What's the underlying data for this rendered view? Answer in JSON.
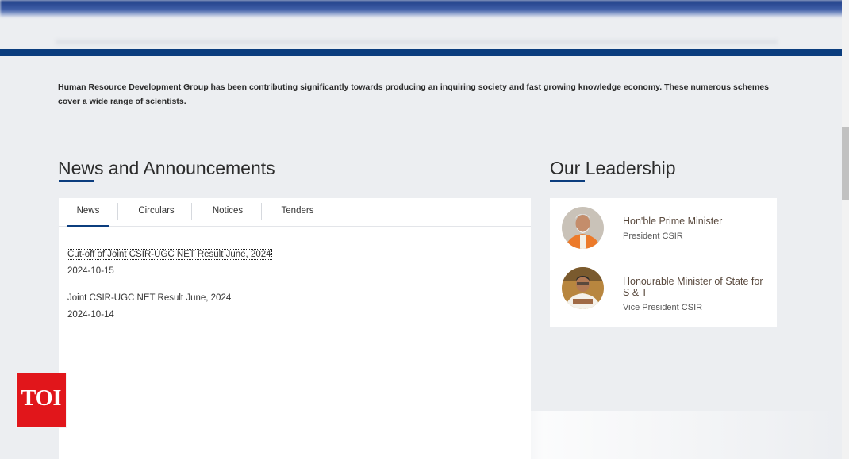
{
  "intro": {
    "text": "Human Resource Development Group has been contributing significantly towards producing an inquiring society and fast growing knowledge economy. These numerous schemes cover a wide range of scientists."
  },
  "news": {
    "title": "News and Announcements",
    "tabs": [
      {
        "label": "News",
        "active": true
      },
      {
        "label": "Circulars",
        "active": false
      },
      {
        "label": "Notices",
        "active": false
      },
      {
        "label": "Tenders",
        "active": false
      }
    ],
    "items": [
      {
        "title": "Cut-off of Joint CSIR-UGC NET Result June, 2024",
        "date": "2024-10-15"
      },
      {
        "title": "Joint CSIR-UGC NET Result June, 2024",
        "date": "2024-10-14"
      }
    ]
  },
  "leadership": {
    "title": "Our Leadership",
    "people": [
      {
        "title": "Hon'ble Prime Minister",
        "role": "President CSIR"
      },
      {
        "title": "Honourable Minister of State for S & T",
        "role": "Vice President CSIR"
      }
    ]
  },
  "watermark": {
    "logo_text": "TOI"
  },
  "colors": {
    "brand_blue": "#0b3d7e",
    "toi_red": "#e1161b",
    "background": "#eceef1"
  }
}
